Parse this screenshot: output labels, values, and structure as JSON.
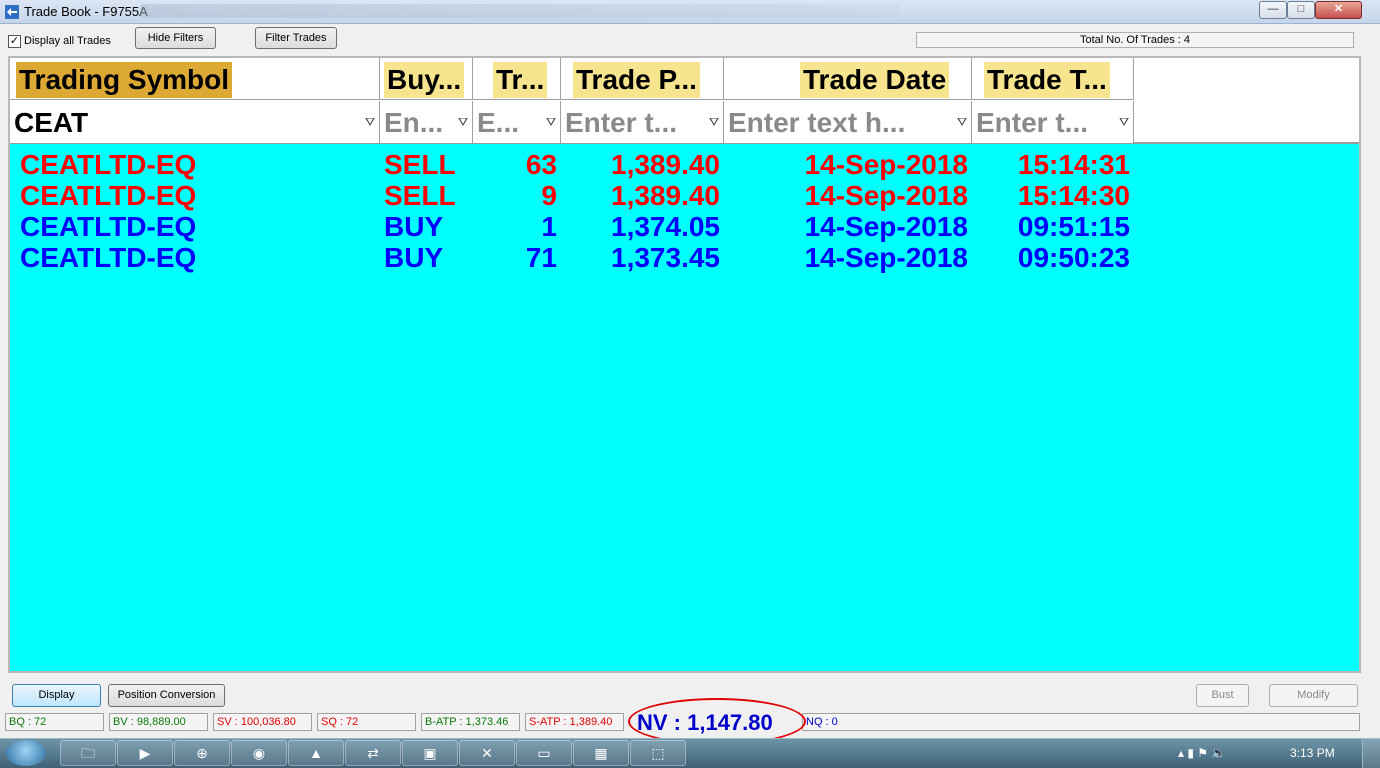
{
  "window": {
    "title": "Trade Book - F9755A",
    "minimize_glyph": "—",
    "maximize_glyph": "□",
    "close_glyph": "✕"
  },
  "toolbar": {
    "display_all_label": "Display all Trades",
    "display_all_checked": true,
    "checkbox_glyph": "✓",
    "hide_filters_label": "Hide Filters",
    "filter_trades_label": "Filter Trades",
    "total_trades": "Total No. Of Trades : 4"
  },
  "grid": {
    "columns": [
      {
        "header": "Trading Symbol",
        "filter_value": "CEAT"
      },
      {
        "header": "Buy...",
        "filter_placeholder": "En..."
      },
      {
        "header": "Tr...",
        "filter_placeholder": "E..."
      },
      {
        "header": "Trade P...",
        "filter_placeholder": "Enter t..."
      },
      {
        "header": "Trade Date",
        "filter_placeholder": "Enter text h..."
      },
      {
        "header": "Trade T...",
        "filter_placeholder": "Enter t..."
      }
    ],
    "filter_icon": "funnel-icon",
    "background_color": "#00ffff",
    "sell_color": "#ff0000",
    "buy_color": "#0000ff",
    "rows": [
      {
        "symbol": "CEATLTD-EQ",
        "side": "SELL",
        "qty": "63",
        "price": "1,389.40",
        "date": "14-Sep-2018",
        "time": "15:14:31"
      },
      {
        "symbol": "CEATLTD-EQ",
        "side": "SELL",
        "qty": "9",
        "price": "1,389.40",
        "date": "14-Sep-2018",
        "time": "15:14:30"
      },
      {
        "symbol": "CEATLTD-EQ",
        "side": "BUY",
        "qty": "1",
        "price": "1,374.05",
        "date": "14-Sep-2018",
        "time": "09:51:15"
      },
      {
        "symbol": "CEATLTD-EQ",
        "side": "BUY",
        "qty": "71",
        "price": "1,373.45",
        "date": "14-Sep-2018",
        "time": "09:50:23"
      }
    ]
  },
  "actions": {
    "display_label": "Display",
    "position_conversion_label": "Position Conversion",
    "bust_label": "Bust",
    "modify_label": "Modify"
  },
  "status": {
    "bq": "BQ : 72",
    "bv": "BV : 98,889.00",
    "sv": "SV : 100,036.80",
    "sq": "SQ : 72",
    "batp": "B-ATP : 1,373.46",
    "satp": "S-ATP : 1,389.40",
    "nv": "NV : 1,147.80",
    "nq": "NQ : 0"
  },
  "taskbar": {
    "clock": "3:13 PM",
    "apps": [
      "explorer-icon",
      "media-player-icon",
      "help-icon",
      "chrome-icon",
      "app-icon",
      "network-icon",
      "chart-icon",
      "excel-icon",
      "window-icon",
      "calculator-icon",
      "pdf-icon"
    ]
  }
}
